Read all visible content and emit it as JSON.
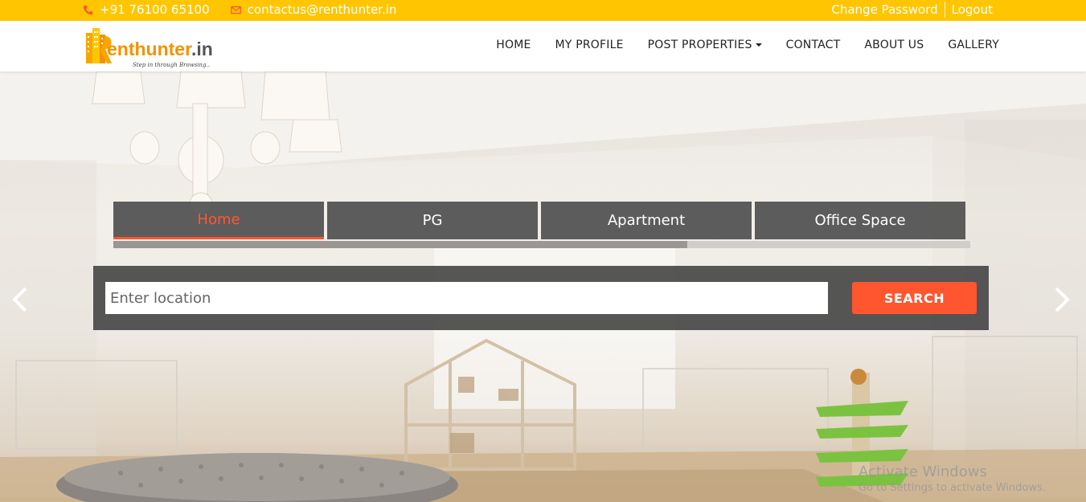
{
  "topbar": {
    "phone": "+91 76100 65100",
    "email": "contactus@renthunter.in",
    "change_password": "Change Password",
    "logout": "Logout",
    "icons": {
      "phone": "phone-icon",
      "email": "envelope-icon"
    }
  },
  "logo": {
    "text": "Renthunter.in",
    "tagline": "Step in through Browsing.."
  },
  "nav": {
    "items": [
      "HOME",
      "MY PROFILE",
      "POST PROPERTIES",
      "CONTACT",
      "ABOUT US",
      "GALLERY"
    ]
  },
  "tabs": {
    "items": [
      "Home",
      "PG",
      "Apartment",
      "Office Space"
    ],
    "active_index": 0,
    "progress_fraction": 0.67
  },
  "search": {
    "placeholder": "Enter location",
    "button_label": "SEARCH"
  },
  "watermark": {
    "line1": "Activate Windows",
    "line2": "Go to Settings to activate Windows."
  },
  "colors": {
    "topbar": "#ffc600",
    "accent": "#ff5630",
    "panel": "#484848"
  }
}
